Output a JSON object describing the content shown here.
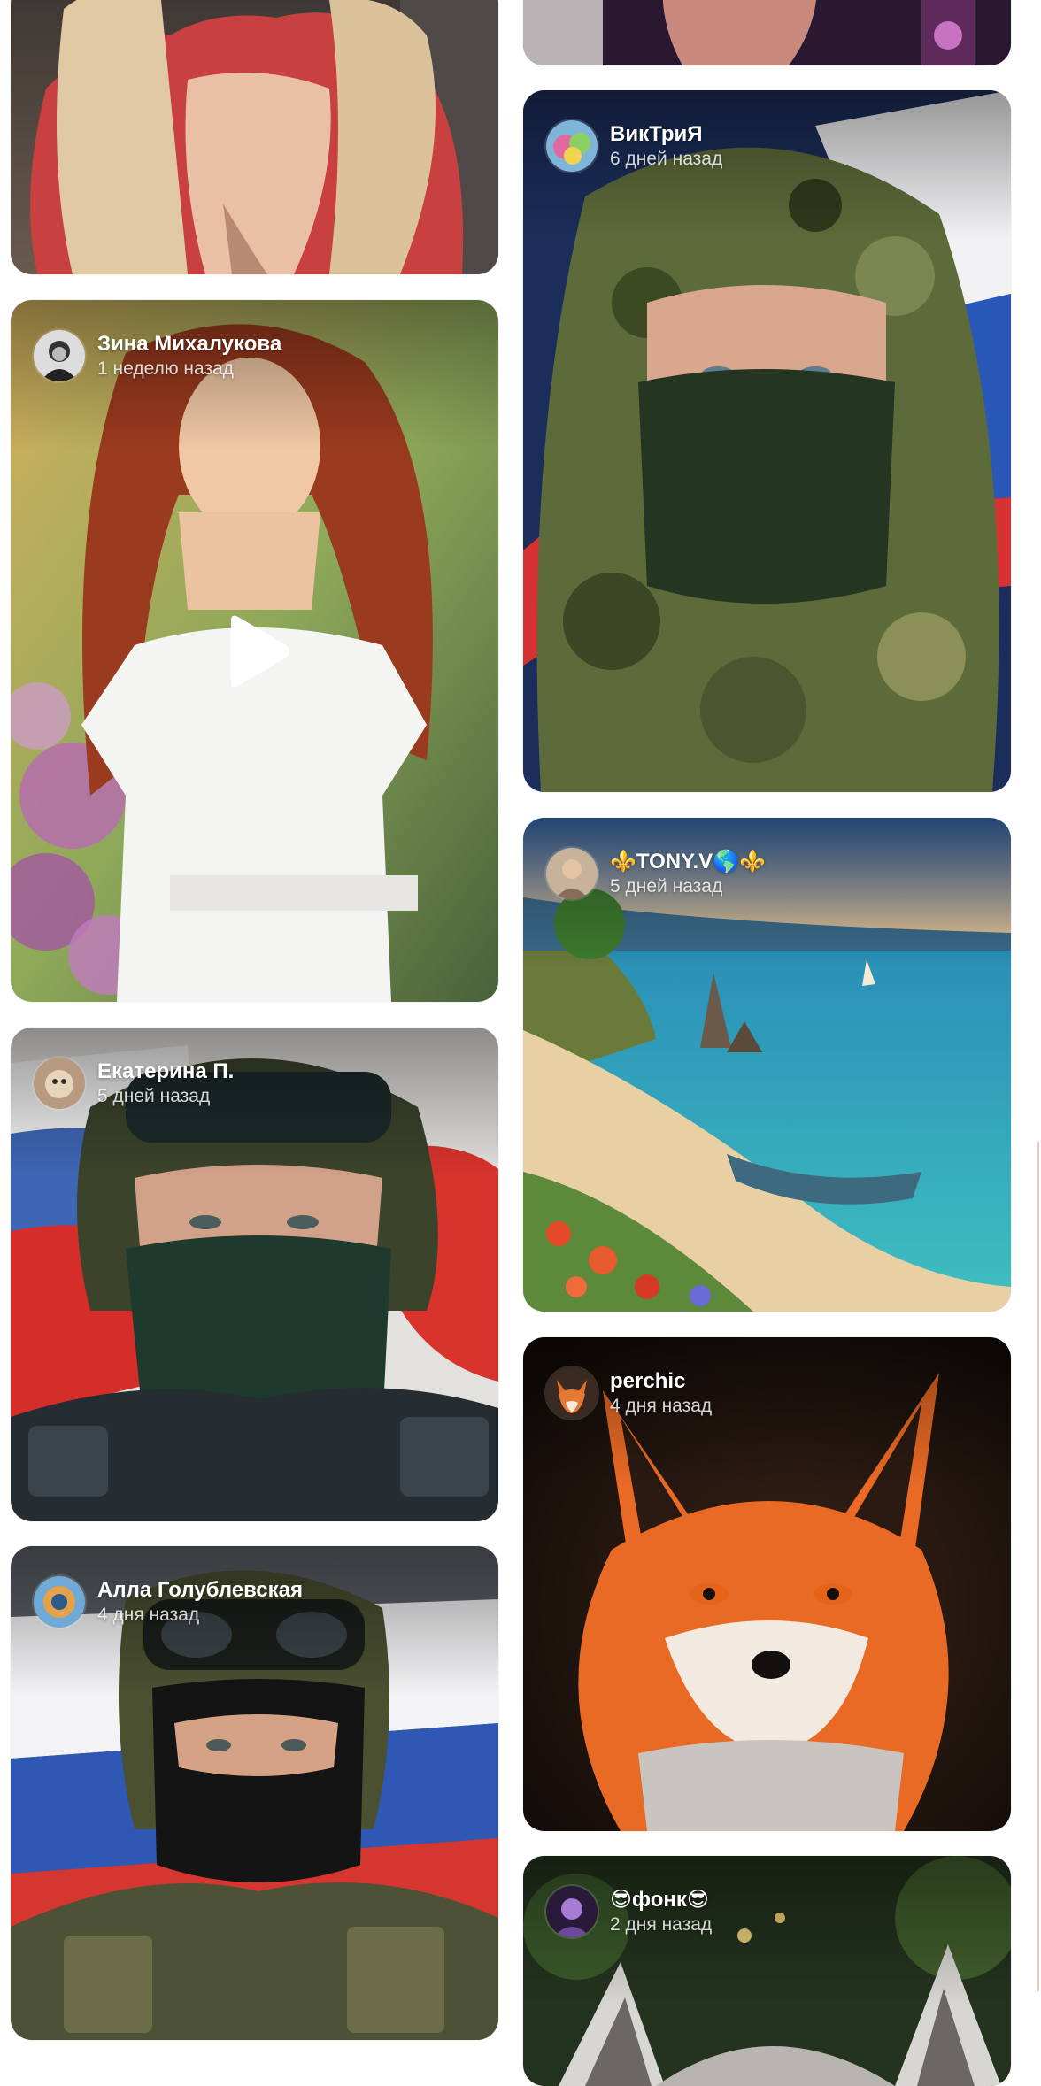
{
  "feed": {
    "posts": [
      {
        "author": "",
        "time": ""
      },
      {
        "author": "",
        "time": ""
      },
      {
        "author": "Зина Михалукова",
        "time": "1 неделю назад",
        "is_video": true
      },
      {
        "author": "ВикТриЯ",
        "time": "6 дней назад"
      },
      {
        "author": "⚜️TONY.V🌎⚜️",
        "time": "5 дней назад"
      },
      {
        "author": "Екатерина П.",
        "time": "5 дней назад"
      },
      {
        "author": "perchic",
        "time": "4 дня назад"
      },
      {
        "author": "Алла Голублевская",
        "time": "4 дня назад"
      },
      {
        "author": "😎фонк😎",
        "time": "2 дня назад"
      }
    ],
    "icons": {
      "play": "play-icon"
    }
  }
}
